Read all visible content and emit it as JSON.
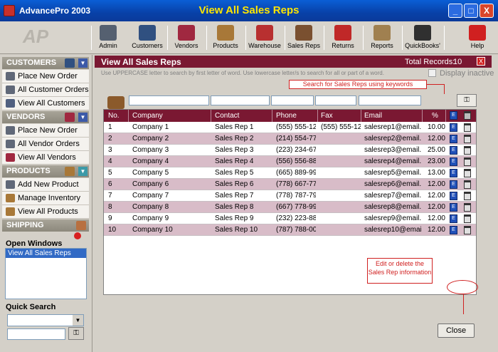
{
  "window": {
    "app_title": "AdvancePro 2003",
    "title": "View All Sales Reps",
    "minimize": "_",
    "maximize": "□",
    "close": "X"
  },
  "toolbar": {
    "logo": "AP",
    "items": [
      {
        "label": "Admin",
        "icon": "admin-icon",
        "color": "#556070"
      },
      {
        "label": "Customers",
        "icon": "customers-icon",
        "color": "#305080"
      },
      {
        "label": "Vendors",
        "icon": "vendors-icon",
        "color": "#a02840"
      },
      {
        "label": "Products",
        "icon": "products-icon",
        "color": "#a87838"
      },
      {
        "label": "Warehouse",
        "icon": "warehouse-icon",
        "color": "#b83030"
      },
      {
        "label": "Sales Reps",
        "icon": "sales-reps-icon",
        "color": "#7a5030"
      },
      {
        "label": "Returns",
        "icon": "returns-icon",
        "color": "#c02828"
      },
      {
        "label": "Reports",
        "icon": "reports-icon",
        "color": "#a08050"
      },
      {
        "label": "QuickBooks'",
        "icon": "quickbooks-icon",
        "color": "#303030"
      },
      {
        "label": "Help",
        "icon": "help-icon",
        "color": "#d02020"
      }
    ]
  },
  "sidebar": {
    "customers": {
      "heading": "CUSTOMERS",
      "items": [
        "Place New Order",
        "All Customer Orders",
        "View All Customers"
      ]
    },
    "vendors": {
      "heading": "VENDORS",
      "items": [
        "Place New Order",
        "All Vendor Orders",
        "View All Vendors"
      ]
    },
    "products": {
      "heading": "PRODUCTS",
      "items": [
        "Add New Product",
        "Manage Inventory",
        "View All Products"
      ]
    },
    "shipping": {
      "heading": "SHIPPING"
    },
    "open_windows": {
      "label": "Open Windows",
      "items": [
        "View All Sales Reps"
      ]
    },
    "quick_search": {
      "label": "Quick Search",
      "value": ""
    }
  },
  "main": {
    "title": "View All Sales Reps",
    "total_label": "Total Records:",
    "total_value": "10",
    "close_x": "X",
    "hint": "Use UPPERCASE letter to search by first letter of word. Use lowercase letter/s to search for all or part of a word.",
    "display_inactive": "Display inactive",
    "search_callout": "Search for Sales Reps using keywords",
    "edit_callout": "Edit or delete the Sales Rep information",
    "columns": [
      "No.",
      "Company",
      "Contact",
      "Phone",
      "Fax",
      "Email",
      "%"
    ],
    "rows": [
      {
        "no": "1",
        "company": "Company 1",
        "contact": "Sales  Rep 1",
        "phone": "(555)  555-12",
        "fax": "(555)  555-12",
        "email": "salesrep1@email.",
        "pct": "10.00"
      },
      {
        "no": "2",
        "company": "Company 2",
        "contact": "Sales Rep 2",
        "phone": "(214)  554-77",
        "fax": "",
        "email": "salesrep2@email.",
        "pct": "12.00"
      },
      {
        "no": "3",
        "company": "Company 3",
        "contact": "Sales  Rep 3",
        "phone": "(223)  234-67",
        "fax": "",
        "email": "salesrep3@email.",
        "pct": "25.00"
      },
      {
        "no": "4",
        "company": "Company 4",
        "contact": "Sales Rep 4",
        "phone": "(556)  556-88",
        "fax": "",
        "email": "salesrep4@email.",
        "pct": "23.00"
      },
      {
        "no": "5",
        "company": "Company 5",
        "contact": "Sales Rep 5",
        "phone": "(665)  889-99",
        "fax": "",
        "email": "salesrep5@email.",
        "pct": "13.00"
      },
      {
        "no": "6",
        "company": "Company 6",
        "contact": "Sales Rep 6",
        "phone": "(778)  667-77",
        "fax": "",
        "email": "salesrep6@email.",
        "pct": "12.00"
      },
      {
        "no": "7",
        "company": "Company 7",
        "contact": "Sales Rep 7",
        "phone": "(778)  787-79",
        "fax": "",
        "email": "salesrep7@email.",
        "pct": "12.00"
      },
      {
        "no": "8",
        "company": "Company 8",
        "contact": "Sales Rep 8",
        "phone": "(667)  778-99",
        "fax": "",
        "email": "salesrep8@email.",
        "pct": "12.00"
      },
      {
        "no": "9",
        "company": "Company 9",
        "contact": "Sales Rep 9",
        "phone": "(232)  223-88",
        "fax": "",
        "email": "salesrep9@email.",
        "pct": "12.00"
      },
      {
        "no": "10",
        "company": "Company 10",
        "contact": "Sales Rep 10",
        "phone": "(787)  788-00",
        "fax": "",
        "email": "salesrep10@email",
        "pct": "12.00"
      }
    ],
    "close_button": "Close"
  },
  "colors": {
    "header": "#7a1832",
    "row_alt": "#d8bcc8",
    "callout": "#d02020",
    "title_text": "#ffe600"
  }
}
